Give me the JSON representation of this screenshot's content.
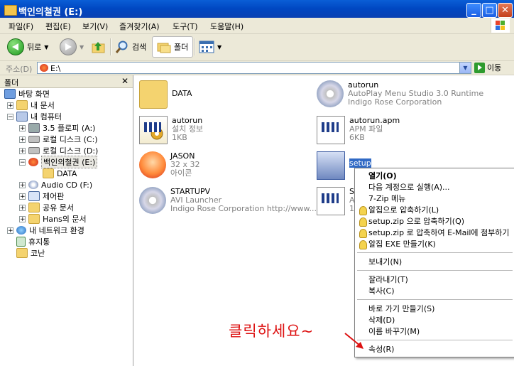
{
  "window": {
    "title": "백인의철권 (E:)",
    "min_label": "_",
    "max_label": "□",
    "close_label": "✕"
  },
  "menubar": [
    "파일(F)",
    "편집(E)",
    "보기(V)",
    "즐겨찾기(A)",
    "도구(T)",
    "도움말(H)"
  ],
  "toolbar": {
    "back": "뒤로",
    "search": "검색",
    "folders": "폴더"
  },
  "address": {
    "label": "주소(D)",
    "value": "E:\\",
    "go": "이동"
  },
  "folder_pane": {
    "title": "폴더",
    "close": "✕",
    "tree": [
      {
        "label": "바탕 화면",
        "icon": "desktop-icon"
      },
      {
        "label": "내 문서",
        "icon": "folder-icon"
      },
      {
        "label": "내 컴퓨터",
        "icon": "computer-icon"
      },
      {
        "label": "3.5 플로피 (A:)",
        "icon": "floppy-icon"
      },
      {
        "label": "로컬 디스크 (C:)",
        "icon": "disk-icon"
      },
      {
        "label": "로컬 디스크 (D:)",
        "icon": "disk-icon"
      },
      {
        "label": "백인의철권 (E:)",
        "icon": "cd-icon"
      },
      {
        "label": "DATA",
        "icon": "folder-icon"
      },
      {
        "label": "Audio CD (F:)",
        "icon": "cd-icon"
      },
      {
        "label": "제어판",
        "icon": "control-panel-icon"
      },
      {
        "label": "공유 문서",
        "icon": "folder-icon"
      },
      {
        "label": "Hans의 문서",
        "icon": "folder-icon"
      },
      {
        "label": "내 네트워크 환경",
        "icon": "network-icon"
      },
      {
        "label": "휴지통",
        "icon": "recycle-bin-icon"
      },
      {
        "label": "코난",
        "icon": "folder-icon"
      }
    ]
  },
  "files": [
    {
      "name": "DATA",
      "sub1": "",
      "sub2": "",
      "icon": "folder-icon"
    },
    {
      "name": "autorun",
      "sub1": "AutoPlay Menu Studio 3.0 Runtime",
      "sub2": "Indigo Rose Corporation",
      "icon": "cd-icon"
    },
    {
      "name": "autorun",
      "sub1": "설치 정보",
      "sub2": "1KB",
      "icon": "setup-info-icon"
    },
    {
      "name": "autorun.apm",
      "sub1": "APM 파일",
      "sub2": "6KB",
      "icon": "document-icon"
    },
    {
      "name": "JASON",
      "sub1": "32 x 32",
      "sub2": "아이콘",
      "icon": "jason-icon"
    },
    {
      "name": "setup",
      "sub1": "",
      "sub2": "",
      "icon": "setup-icon"
    },
    {
      "name": "STARTUPV",
      "sub1": "AVI Launcher",
      "sub2": "Indigo Rose Corporation http://www....",
      "icon": "cd-icon"
    },
    {
      "name": "S",
      "sub1": "A",
      "sub2": "1",
      "icon": "document-icon"
    }
  ],
  "context_menu": {
    "items": [
      {
        "label": "열기(O)",
        "bold": true
      },
      {
        "label": "다음 계정으로 실행(A)..."
      },
      {
        "label": "7-Zip 메뉴"
      },
      {
        "label": "알집으로 압축하기(L)",
        "icon": true
      },
      {
        "label": "setup.zip 으로 압축하기(Q)",
        "icon": true
      },
      {
        "label": "setup.zip 로 압축하여 E-Mail에 첨부하기",
        "icon": true
      },
      {
        "label": "알집 EXE 만들기(K)",
        "icon": true
      },
      {
        "label": "보내기(N)"
      },
      {
        "label": "잘라내기(T)"
      },
      {
        "label": "복사(C)"
      },
      {
        "label": "바로 가기 만들기(S)"
      },
      {
        "label": "삭제(D)"
      },
      {
        "label": "이름 바꾸기(M)"
      },
      {
        "label": "속성(R)"
      }
    ]
  },
  "annotation": "클릭하세요~",
  "colors": {
    "titlebar": "#0a5ed6",
    "selection": "#316ac5",
    "annotation": "#dd1111"
  }
}
